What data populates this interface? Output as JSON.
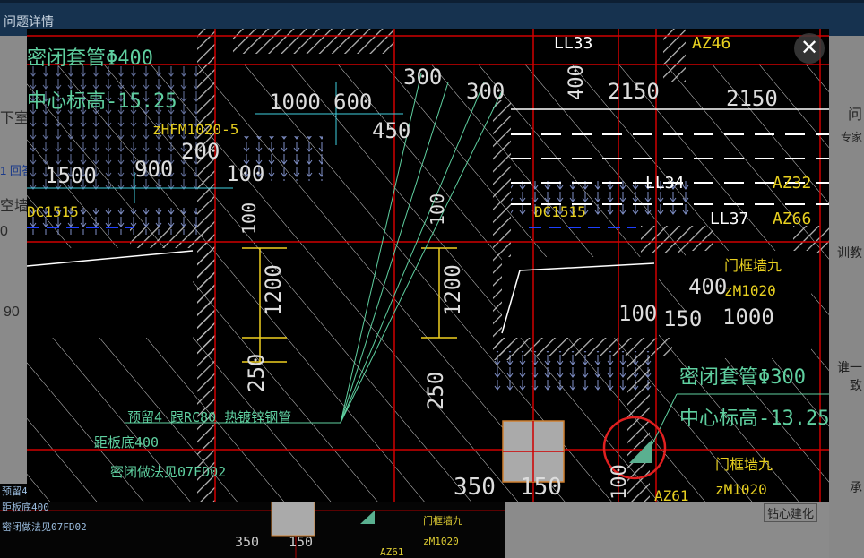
{
  "page": {
    "title": "问题详情",
    "left_stubs": [
      "下室",
      "1 回答",
      "空墙",
      "0",
      "90"
    ],
    "right_stubs": [
      "问",
      "专家",
      "训教",
      "谁一",
      "致",
      "承"
    ],
    "bottom_stub": "钻心建化"
  },
  "drawing": {
    "labels_green": [
      {
        "id": "seal-sleeve-1",
        "text": "密闭套管Φ400"
      },
      {
        "id": "center-elev-1",
        "text": "中心标高-15.25"
      },
      {
        "id": "seal-sleeve-2",
        "text": "密闭套管Φ300"
      },
      {
        "id": "center-elev-2",
        "text": "中心标高-13.25"
      },
      {
        "id": "reserve-pipe",
        "text": "预留4 跟RC80 热镀锌钢管"
      },
      {
        "id": "board-bottom",
        "text": "距板底400"
      },
      {
        "id": "seal-method",
        "text": "密闭做法见07FD02"
      }
    ],
    "labels_yellow": [
      {
        "id": "door-hfm",
        "text": "zHFM1020-5"
      },
      {
        "id": "dc1515-left",
        "text": "DC1515"
      },
      {
        "id": "dc1515-mid",
        "text": "DC1515"
      },
      {
        "id": "az46",
        "text": "AZ46"
      },
      {
        "id": "az32",
        "text": "AZ32"
      },
      {
        "id": "az66",
        "text": "AZ66"
      },
      {
        "id": "door-frame-1",
        "text": "门框墙九"
      },
      {
        "id": "door-m1020-1",
        "text": "zM1020"
      },
      {
        "id": "door-frame-2",
        "text": "门框墙九"
      },
      {
        "id": "door-m1020-2",
        "text": "zM1020"
      },
      {
        "id": "az61",
        "text": "AZ61"
      }
    ],
    "labels_white": [
      {
        "id": "ll33",
        "text": "LL33"
      },
      {
        "id": "ll34",
        "text": "LL34"
      },
      {
        "id": "ll37",
        "text": "LL37"
      }
    ],
    "dimensions": [
      {
        "id": "d1000",
        "text": "1000"
      },
      {
        "id": "d600",
        "text": "600"
      },
      {
        "id": "d300a",
        "text": "300"
      },
      {
        "id": "d300b",
        "text": "300"
      },
      {
        "id": "d450",
        "text": "450"
      },
      {
        "id": "d200",
        "text": "200"
      },
      {
        "id": "d1500",
        "text": "1500"
      },
      {
        "id": "d900",
        "text": "900"
      },
      {
        "id": "d100a",
        "text": "100"
      },
      {
        "id": "d100b",
        "text": "100"
      },
      {
        "id": "d100c",
        "text": "100"
      },
      {
        "id": "d1200a",
        "text": "1200"
      },
      {
        "id": "d1200b",
        "text": "1200"
      },
      {
        "id": "d250a",
        "text": "250"
      },
      {
        "id": "d250b",
        "text": "250"
      },
      {
        "id": "d400a",
        "text": "400"
      },
      {
        "id": "d2150a",
        "text": "2150"
      },
      {
        "id": "d2150b",
        "text": "2150"
      },
      {
        "id": "d400b",
        "text": "400"
      },
      {
        "id": "d150a",
        "text": "150"
      },
      {
        "id": "d1000b",
        "text": "1000"
      },
      {
        "id": "d100d",
        "text": "100"
      },
      {
        "id": "d350",
        "text": "350"
      },
      {
        "id": "d150b",
        "text": "150"
      },
      {
        "id": "d100e",
        "text": "100"
      }
    ]
  },
  "thumb": {
    "labels": [
      "预留4",
      "距板底400",
      "密闭做法见07FD02",
      "350",
      "150",
      "门框墙九",
      "zM1020",
      "AZ61"
    ]
  },
  "close_label": "✕"
}
